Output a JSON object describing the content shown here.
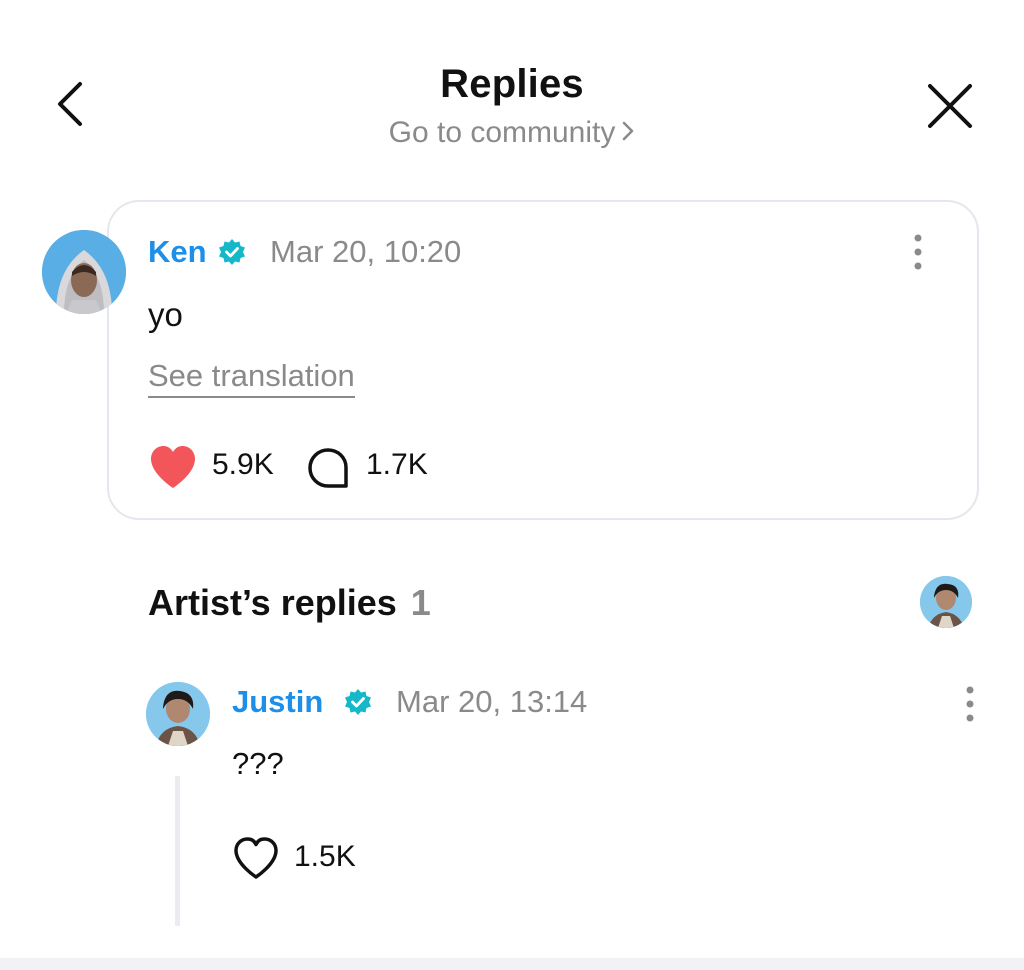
{
  "header": {
    "title": "Replies",
    "community_link": "Go to community",
    "back_icon": "chevron-left-icon",
    "close_icon": "close-icon"
  },
  "post": {
    "author": "Ken",
    "timestamp": "Mar 20, 10:20",
    "text": "yo",
    "translate_label": "See translation",
    "likes": "5.9K",
    "comments": "1.7K",
    "liked": true
  },
  "artist_replies": {
    "title": "Artist’s replies",
    "count": "1",
    "reply": {
      "author": "Justin",
      "timestamp": "Mar 20, 13:14",
      "text": "???",
      "likes": "1.5K",
      "liked": false
    }
  },
  "colors": {
    "name_blue": "#1e8fe8",
    "verified_teal": "#14b8c8",
    "muted_gray": "#8a8a8a",
    "like_red": "#f2555a",
    "card_border": "#e6e6ee"
  }
}
